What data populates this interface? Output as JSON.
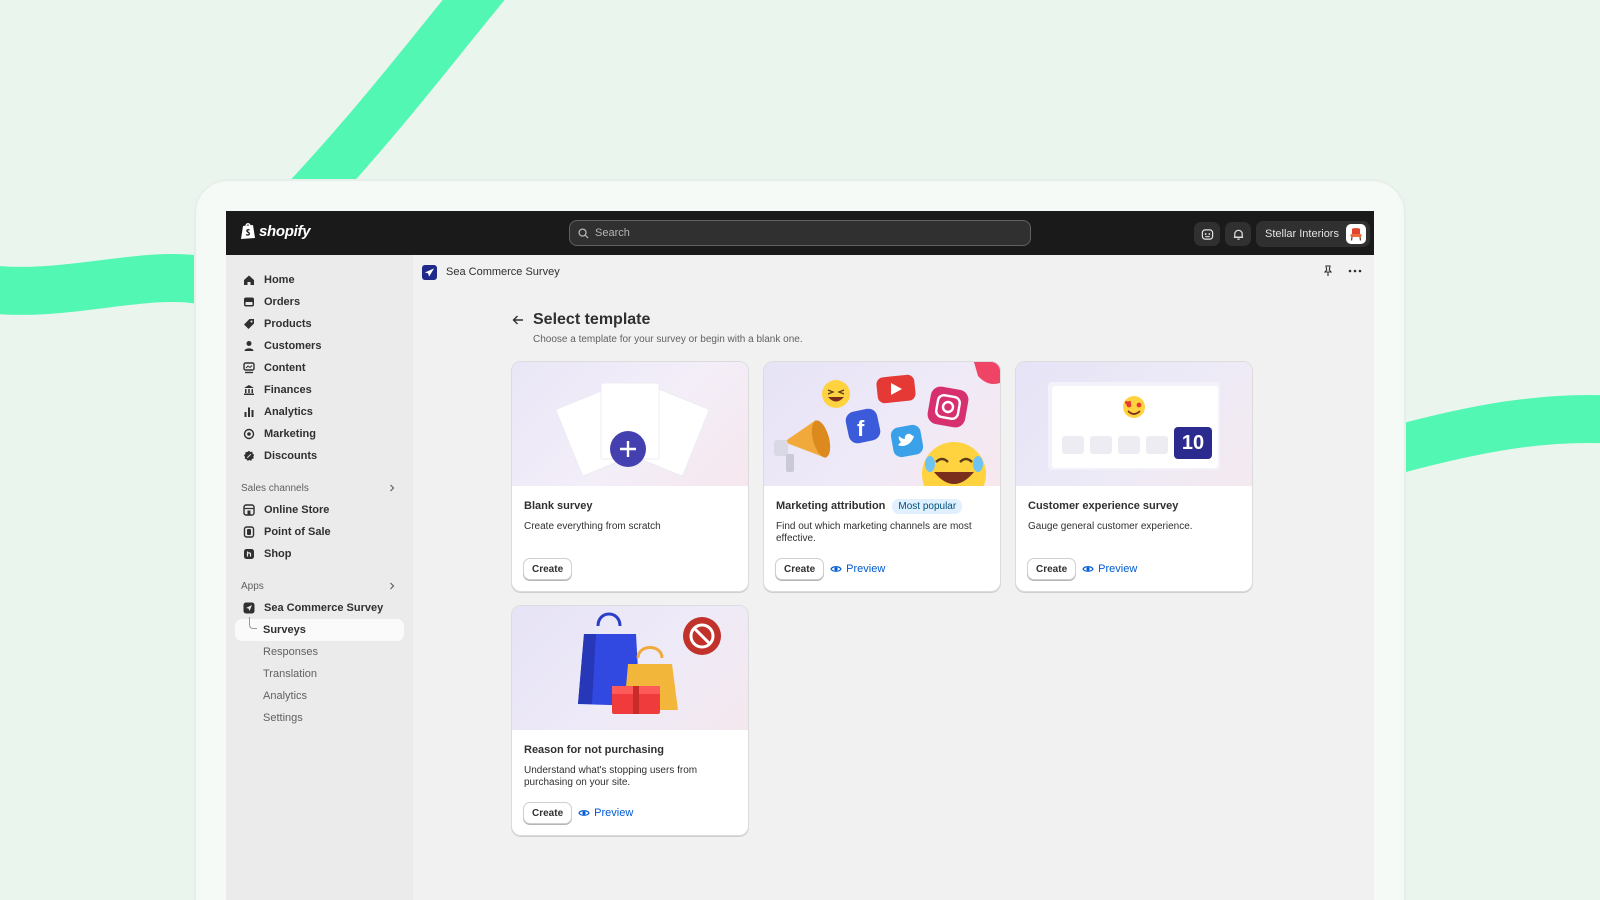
{
  "topbar": {
    "logo_text": "shopify",
    "search_placeholder": "Search",
    "store_name": "Stellar Interiors"
  },
  "sidebar": {
    "main_items": [
      {
        "label": "Home",
        "icon": "home-icon"
      },
      {
        "label": "Orders",
        "icon": "orders-icon"
      },
      {
        "label": "Products",
        "icon": "tag-icon"
      },
      {
        "label": "Customers",
        "icon": "person-icon"
      },
      {
        "label": "Content",
        "icon": "content-icon"
      },
      {
        "label": "Finances",
        "icon": "bank-icon"
      },
      {
        "label": "Analytics",
        "icon": "bar-chart-icon"
      },
      {
        "label": "Marketing",
        "icon": "target-icon"
      },
      {
        "label": "Discounts",
        "icon": "discount-icon"
      }
    ],
    "sales_channels_label": "Sales channels",
    "sales_channels": [
      {
        "label": "Online Store",
        "icon": "store-icon"
      },
      {
        "label": "Point of Sale",
        "icon": "pos-icon"
      },
      {
        "label": "Shop",
        "icon": "shop-icon"
      }
    ],
    "apps_label": "Apps",
    "app_name": "Sea Commerce Survey",
    "app_subitems": [
      "Surveys",
      "Responses",
      "Translation",
      "Analytics",
      "Settings"
    ],
    "active_subitem": "Surveys"
  },
  "appbar": {
    "title": "Sea Commerce Survey"
  },
  "page": {
    "title": "Select template",
    "subtitle": "Choose a template for your survey or begin with a blank one."
  },
  "cards": [
    {
      "title": "Blank survey",
      "badge": "",
      "description": "Create everything from scratch",
      "create_label": "Create",
      "preview_label": ""
    },
    {
      "title": "Marketing attribution",
      "badge": "Most popular",
      "description": "Find out which marketing channels are most effective.",
      "create_label": "Create",
      "preview_label": "Preview"
    },
    {
      "title": "Customer experience survey",
      "badge": "",
      "description": "Gauge general customer experience.",
      "create_label": "Create",
      "preview_label": "Preview",
      "image_score": "10"
    },
    {
      "title": "Reason for not purchasing",
      "badge": "",
      "description": "Understand what's stopping users from purchasing on your site.",
      "create_label": "Create",
      "preview_label": "Preview"
    }
  ],
  "colors": {
    "accent_green": "#4ef7b4",
    "topbar": "#1a1a1a",
    "link": "#005bd3",
    "app_brand": "#1f2a8a"
  }
}
